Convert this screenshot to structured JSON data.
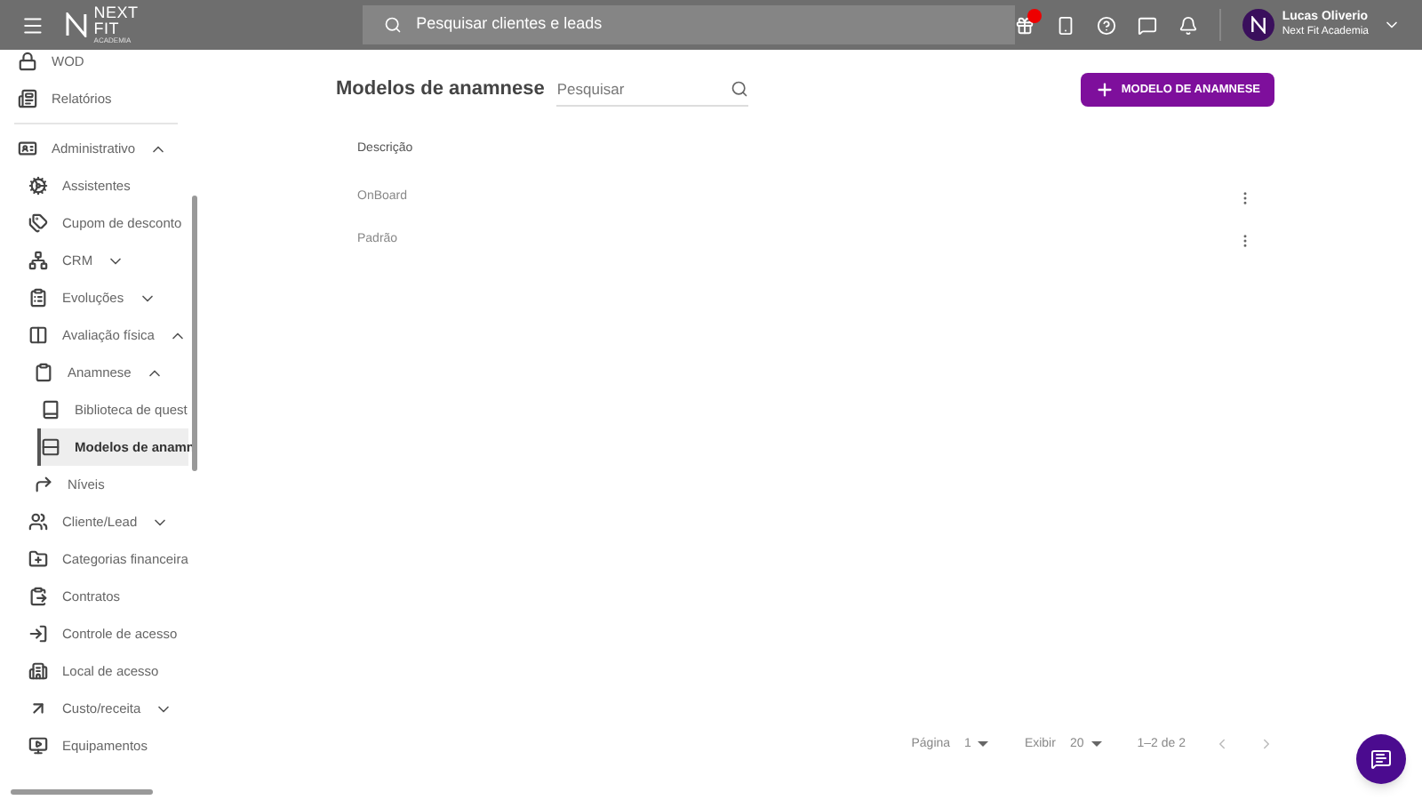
{
  "topbar": {
    "logo": {
      "name": "NEXT FIT",
      "subtitle": "ACADEMIA"
    },
    "search": {
      "placeholder": "Pesquisar clientes e leads"
    },
    "notification_dot": true,
    "user": {
      "name": "Lucas Oliverio",
      "company": "Next Fit Academia"
    }
  },
  "sidebar": {
    "items": [
      {
        "label": "WOD"
      },
      {
        "label": "Relatórios"
      },
      {
        "label": "Administrativo",
        "expanded": true,
        "children": [
          {
            "label": "Assistentes"
          },
          {
            "label": "Cupom de desconto"
          },
          {
            "label": "CRM",
            "expanded": false
          },
          {
            "label": "Evoluções",
            "expanded": false
          },
          {
            "label": "Avaliação física",
            "expanded": true,
            "children": [
              {
                "label": "Anamnese",
                "expanded": true,
                "children": [
                  {
                    "label": "Biblioteca de quest",
                    "selected": false
                  },
                  {
                    "label": "Modelos de anamn",
                    "selected": true
                  }
                ]
              },
              {
                "label": "Níveis"
              }
            ]
          },
          {
            "label": "Cliente/Lead",
            "expanded": false
          },
          {
            "label": "Categorias financeira"
          },
          {
            "label": "Contratos"
          },
          {
            "label": "Controle de acesso"
          },
          {
            "label": "Local de acesso"
          },
          {
            "label": "Custo/receita",
            "expanded": false
          },
          {
            "label": "Equipamentos"
          }
        ]
      }
    ]
  },
  "main": {
    "title": "Modelos de anamnese",
    "search": {
      "placeholder": "Pesquisar"
    },
    "add_button": "MODELO DE ANAMNESE",
    "table": {
      "columns": [
        "Descrição"
      ],
      "rows": [
        [
          "OnBoard"
        ],
        [
          "Padrão"
        ]
      ]
    },
    "pagination": {
      "page_label": "Página",
      "page": "1",
      "show_label": "Exibir",
      "page_size": "20",
      "range": "1–2 de 2"
    }
  }
}
